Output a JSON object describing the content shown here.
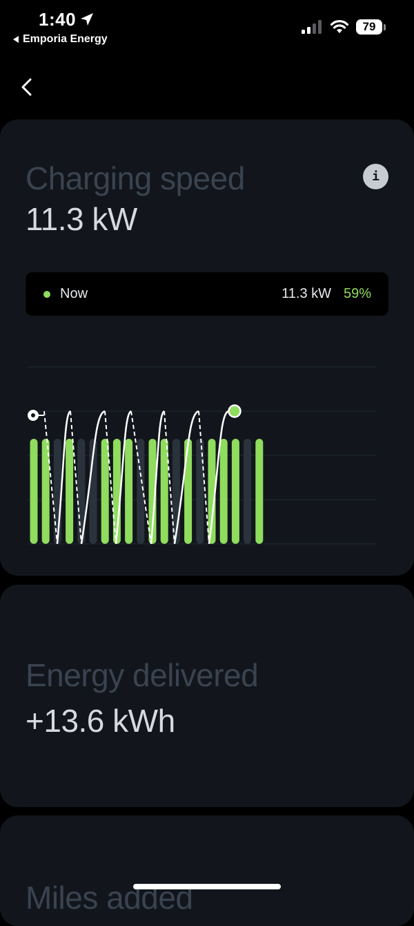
{
  "status_bar": {
    "time": "1:40",
    "back_app": "Emporia Energy",
    "battery": "79"
  },
  "charging_card": {
    "title": "Charging speed",
    "value": "11.3 kW",
    "info_label": "i",
    "now": {
      "label": "Now",
      "kw": "11.3 kW",
      "percent": "59%"
    }
  },
  "energy_card": {
    "title": "Energy delivered",
    "value": "+13.6 kWh"
  },
  "miles_card": {
    "title": "Miles added"
  },
  "colors": {
    "accent_green": "#8fdc5e",
    "inactive_bar": "#2a333c",
    "card_bg": "#12161c",
    "grid": "#232a33"
  },
  "chart_data": {
    "type": "bar",
    "series": [
      {
        "values": [
          1,
          1,
          0,
          1,
          0,
          0,
          1,
          1,
          1,
          0,
          1,
          1,
          0,
          1,
          0,
          1,
          1,
          1,
          0,
          1
        ]
      }
    ],
    "ylim": [
      0,
      1
    ]
  }
}
